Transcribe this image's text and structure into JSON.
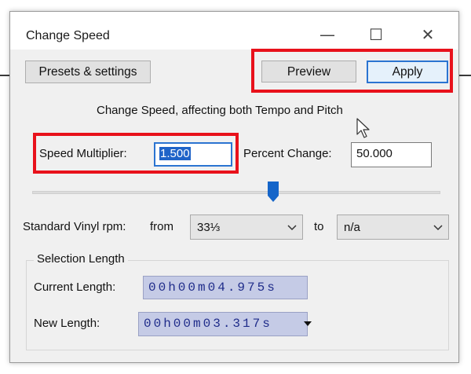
{
  "dialog": {
    "title": "Change Speed",
    "window_controls": {
      "minimize": "—",
      "maximize": "☐",
      "close": "✕"
    }
  },
  "toolbar": {
    "presets_label": "Presets & settings",
    "preview_label": "Preview",
    "apply_label": "Apply"
  },
  "description": "Change Speed, affecting both Tempo and Pitch",
  "speed": {
    "multiplier_label": "Speed Multiplier:",
    "multiplier_value": "1.500",
    "percent_label": "Percent Change:",
    "percent_value": "50.000"
  },
  "slider": {
    "level_fraction": 0.58
  },
  "vinyl": {
    "label": "Standard Vinyl rpm:",
    "from_label": "from",
    "from_value": "33⅓",
    "to_label": "to",
    "to_value": "n/a"
  },
  "selection": {
    "group_title": "Selection Length",
    "current_label": "Current Length:",
    "current_value": "00h00m04.975s",
    "new_label": "New Length:",
    "new_value": "00h00m03.317s"
  },
  "colors": {
    "highlight": "#e8111b",
    "accent": "#2b74d1",
    "time_text": "#1f2c8a",
    "time_bg": "#c5cbe6"
  },
  "icons": {
    "cursor": "mouse-pointer-icon",
    "chevron": "chevron-down-icon"
  }
}
